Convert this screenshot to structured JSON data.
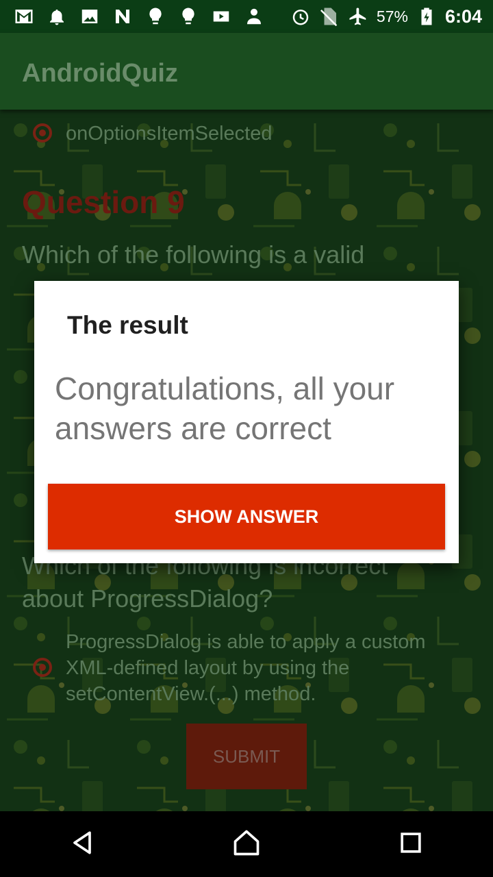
{
  "status_bar": {
    "time": "6:04",
    "battery_percent": "57%",
    "left_icons": [
      "gmail-icon",
      "bell-icon",
      "image-icon",
      "n-icon",
      "bulb-icon",
      "bulb-icon",
      "youtube-icon",
      "person-icon"
    ],
    "right_icons": [
      "alarm-icon",
      "no-sim-icon",
      "airplane-icon",
      "battery-icon"
    ]
  },
  "app_bar": {
    "title": "AndroidQuiz"
  },
  "quiz": {
    "prev_option": "onOptionsItemSelected",
    "question9_heading": "Question 9",
    "question9_text": "Which of the following is a valid",
    "question10_text_line1": "Which of the following is incorrect",
    "question10_text_line2": "about ProgressDialog?",
    "question10_option": "ProgressDialog is able to apply a custom XML-defined layout by using the setContentView.(...) method.",
    "submit_label": "SUBMIT"
  },
  "dialog": {
    "title": "The result",
    "message": "Congratulations, all your answers are correct",
    "button_label": "SHOW ANSWER"
  },
  "colors": {
    "status_bar": "#0b3d15",
    "dialog_button": "#dd2c00",
    "background_green": "#2e7a32"
  },
  "nav_bar": {
    "icons": [
      "back-icon",
      "home-icon",
      "recents-icon"
    ]
  }
}
